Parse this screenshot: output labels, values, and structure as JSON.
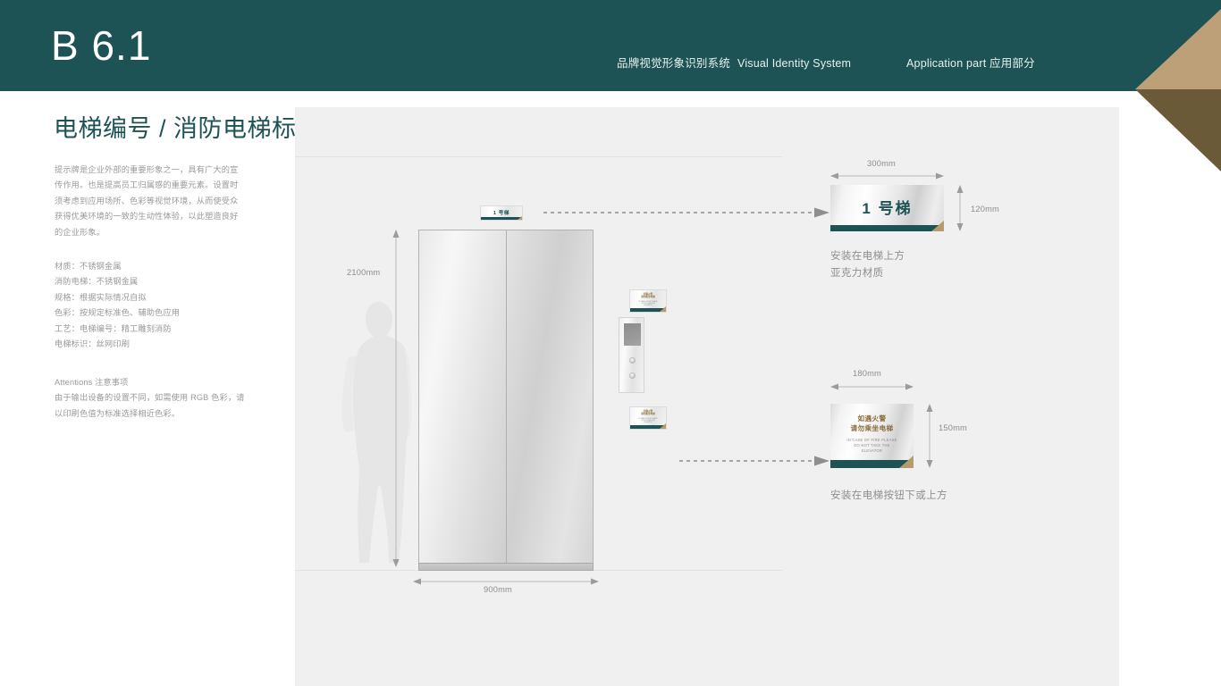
{
  "header": {
    "code": "B 6.1",
    "meta_cn": "品牌视觉形象识别系统",
    "meta_en": "Visual Identity System",
    "right": "Application part  应用部分"
  },
  "title": "电梯编号 / 消防电梯标识",
  "left_column": {
    "description": "提示牌是企业外部的重要形象之一，具有广大的宣传作用。也是提高员工归属感的重要元素。设置时须考虑到应用场所、色彩等视觉环境，从而使受众获得优美环境的一致的生动性体验，以此塑造良好的企业形象。",
    "specs": [
      "材质：不锈钢金属",
      "消防电梯：不锈钢金属",
      "规格：根据实际情况自拟",
      "色彩：按规定标准色、辅助色应用",
      "工艺：电梯编号：精工雕刻消防",
      "电梯标识：丝网印刷"
    ],
    "attentions_title": "Attentions 注意事项",
    "attentions_body": "由于输出设备的设置不同，如需使用 RGB 色彩，请以印刷色值为标准选择相近色彩。"
  },
  "diagram": {
    "height_label": "2100mm",
    "width_label": "900mm",
    "door_sign_text": "1 号梯"
  },
  "sign_elevator_number": {
    "text": "1 号梯",
    "width_label": "300mm",
    "height_label": "120mm",
    "caption_line1": "安装在电梯上方",
    "caption_line2": "亚克力材质"
  },
  "sign_fire": {
    "cn_line1": "如遇火警",
    "cn_line2": "请勿乘坐电梯",
    "en_line1": "IN CASE OF FIRE  PLEASE",
    "en_line2": "DO NOT TAKE THE",
    "en_line3": "ELEVATOR",
    "width_label": "180mm",
    "height_label": "150mm",
    "caption": "安装在电梯按钮下或上方"
  },
  "colors": {
    "brand_teal": "#1e5355",
    "accent_gold": "#b79a6d",
    "accent_gold_dark": "#6b5a38",
    "panel_bg": "#f0f0f0",
    "text_muted": "#9a9a9a"
  }
}
